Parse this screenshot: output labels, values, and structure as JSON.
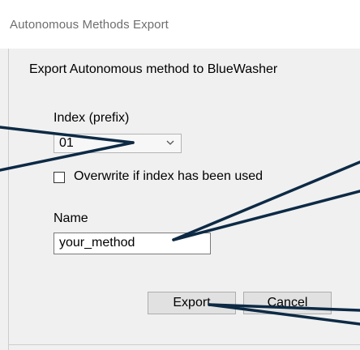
{
  "window": {
    "title": "Autonomous Methods Export"
  },
  "form": {
    "section_title": "Export Autonomous method to BlueWasher",
    "index_label": "Index (prefix)",
    "index_value": "01",
    "overwrite_label": "Overwrite if index has been used",
    "overwrite_checked": false,
    "name_label": "Name",
    "name_value": "your_method"
  },
  "buttons": {
    "export_label": "Export",
    "cancel_label": "Cancel"
  },
  "icons": {
    "dropdown": "chevron-down-icon",
    "callout_color": "#0d2a45"
  }
}
